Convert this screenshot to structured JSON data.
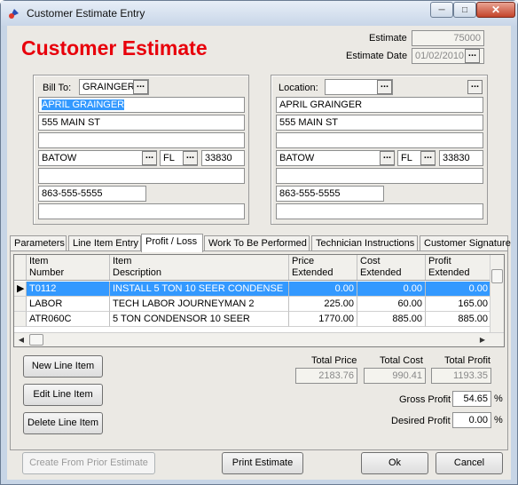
{
  "window": {
    "title": "Customer Estimate Entry"
  },
  "header": {
    "title": "Customer Estimate",
    "estimate_label": "Estimate",
    "estimate_value": "75000",
    "date_label": "Estimate Date",
    "date_value": "01/02/2010"
  },
  "bill_to": {
    "label": "Bill To:",
    "code": "GRAINGER",
    "name": "APRIL GRAINGER",
    "address1": "555 MAIN ST",
    "address2": "",
    "city": "BATOW",
    "state": "FL",
    "zip": "33830",
    "extra": "",
    "phone": "863-555-5555",
    "notes": ""
  },
  "location": {
    "label": "Location:",
    "code": "",
    "name": "APRIL GRAINGER",
    "address1": "555 MAIN ST",
    "address2": "",
    "city": "BATOW",
    "state": "FL",
    "zip": "33830",
    "extra": "",
    "phone": "863-555-5555",
    "notes": ""
  },
  "tabs": [
    {
      "label": "Parameters"
    },
    {
      "label": "Line Item Entry"
    },
    {
      "label": "Profit / Loss"
    },
    {
      "label": "Work To Be Performed"
    },
    {
      "label": "Technician Instructions"
    },
    {
      "label": "Customer Signature"
    }
  ],
  "grid": {
    "columns": [
      {
        "line1": "Item",
        "line2": "Number"
      },
      {
        "line1": "Item",
        "line2": "Description"
      },
      {
        "line1": "Price",
        "line2": "Extended"
      },
      {
        "line1": "Cost",
        "line2": "Extended"
      },
      {
        "line1": "Profit",
        "line2": "Extended"
      }
    ],
    "rows": [
      {
        "number": "T0112",
        "description": "INSTALL 5 TON 10 SEER CONDENSE",
        "price": "0.00",
        "cost": "0.00",
        "profit": "0.00"
      },
      {
        "number": "LABOR",
        "description": "TECH LABOR JOURNEYMAN 2",
        "price": "225.00",
        "cost": "60.00",
        "profit": "165.00"
      },
      {
        "number": "ATR060C",
        "description": "5 TON CONDENSOR 10 SEER",
        "price": "1770.00",
        "cost": "885.00",
        "profit": "885.00"
      }
    ]
  },
  "actions": {
    "new_line": "New Line Item",
    "edit_line": "Edit Line Item",
    "delete_line": "Delete Line Item"
  },
  "totals": {
    "price_label": "Total Price",
    "price_value": "2183.76",
    "cost_label": "Total Cost",
    "cost_value": "990.41",
    "profit_label": "Total Profit",
    "profit_value": "1193.35",
    "gross_label": "Gross Profit",
    "gross_value": "54.65",
    "desired_label": "Desired Profit",
    "desired_value": "0.00",
    "pct": "%"
  },
  "footer": {
    "create_prior": "Create From Prior Estimate",
    "print": "Print Estimate",
    "ok": "Ok",
    "cancel": "Cancel"
  }
}
